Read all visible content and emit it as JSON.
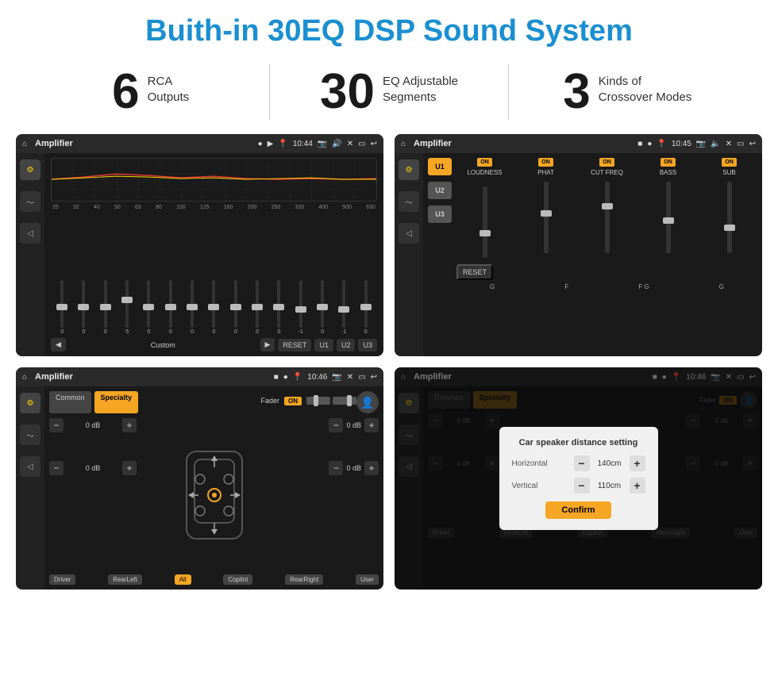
{
  "page": {
    "title": "Buith-in 30EQ DSP Sound System",
    "stats": [
      {
        "number": "6",
        "line1": "RCA",
        "line2": "Outputs"
      },
      {
        "number": "30",
        "line1": "EQ Adjustable",
        "line2": "Segments"
      },
      {
        "number": "3",
        "line1": "Kinds of",
        "line2": "Crossover Modes"
      }
    ],
    "screens": [
      {
        "id": "screen1",
        "topbar": {
          "title": "Amplifier",
          "time": "10:44"
        },
        "type": "eq",
        "freqs": [
          "25",
          "32",
          "40",
          "50",
          "63",
          "80",
          "100",
          "125",
          "160",
          "200",
          "250",
          "320",
          "400",
          "500",
          "630"
        ],
        "values": [
          "0",
          "0",
          "0",
          "5",
          "0",
          "0",
          "0",
          "0",
          "0",
          "0",
          "0",
          "-1",
          "0",
          "-1"
        ],
        "presets": [
          "Custom",
          "RESET",
          "U1",
          "U2",
          "U3"
        ]
      },
      {
        "id": "screen2",
        "topbar": {
          "title": "Amplifier",
          "time": "10:45"
        },
        "type": "crossover",
        "presets": [
          "U1",
          "U2",
          "U3"
        ],
        "channels": [
          {
            "name": "LOUDNESS",
            "on": true
          },
          {
            "name": "PHAT",
            "on": true
          },
          {
            "name": "CUT FREQ",
            "on": true
          },
          {
            "name": "BASS",
            "on": true
          },
          {
            "name": "SUB",
            "on": true
          }
        ],
        "reset": "RESET"
      },
      {
        "id": "screen3",
        "topbar": {
          "title": "Amplifier",
          "time": "10:46"
        },
        "type": "fader",
        "tabs": [
          "Common",
          "Specialty"
        ],
        "activeTab": 1,
        "faderLabel": "Fader",
        "faderOn": "ON",
        "dbValues": [
          "0 dB",
          "0 dB",
          "0 dB",
          "0 dB"
        ],
        "positions": [
          "Driver",
          "RearLeft",
          "All",
          "Copilot",
          "RearRight",
          "User"
        ]
      },
      {
        "id": "screen4",
        "topbar": {
          "title": "Amplifier",
          "time": "10:46"
        },
        "type": "fader-dialog",
        "tabs": [
          "Common",
          "Specialty"
        ],
        "activeTab": 1,
        "dialog": {
          "title": "Car speaker distance setting",
          "horizontal_label": "Horizontal",
          "horizontal_value": "140cm",
          "vertical_label": "Vertical",
          "vertical_value": "110cm",
          "confirm_label": "Confirm"
        },
        "dbValues": [
          "0 dB",
          "0 dB"
        ],
        "positions": [
          "Driver",
          "RearLeft",
          "Copilot",
          "RearRight",
          "User"
        ]
      }
    ]
  }
}
